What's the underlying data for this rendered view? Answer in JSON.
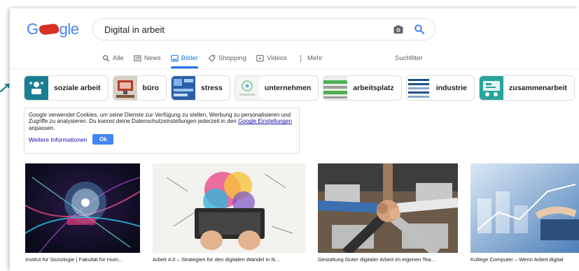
{
  "logo": {
    "g": "G",
    "gle": "gle"
  },
  "search": {
    "query": "Digital in arbeit"
  },
  "tabs": [
    {
      "label": "Alle",
      "icon": "search-icon"
    },
    {
      "label": "News",
      "icon": "news-icon"
    },
    {
      "label": "Bilder",
      "icon": "image-icon"
    },
    {
      "label": "Shopping",
      "icon": "tag-icon"
    },
    {
      "label": "Videos",
      "icon": "video-icon"
    },
    {
      "label": "Mehr",
      "icon": "more-vert-icon"
    }
  ],
  "filter_label": "Suchfilter",
  "chips": [
    {
      "label": "soziale arbeit"
    },
    {
      "label": "büro"
    },
    {
      "label": "stress"
    },
    {
      "label": "unternehmen"
    },
    {
      "label": "arbeitsplatz"
    },
    {
      "label": "industrie"
    },
    {
      "label": "zusammenarbeit"
    }
  ],
  "cookie": {
    "text_before": "Google verwendet Cookies, um seine Dienste zur Verfügung zu stellen, Werbung zu personalisieren und Zugriffe zu analysieren. Du kannst deine Datenschutzeinstellungen jederzeit in den ",
    "link": "Google Einstellungen",
    "text_after": " anpassen.",
    "more": "Weitere Informationen",
    "ok": "Ok"
  },
  "results": [
    {
      "caption": "Institut für Soziologie | Fakultät für Hum..."
    },
    {
      "caption": "Arbeit 4.0 – Strategien für den digitalen Wandel in N..."
    },
    {
      "caption": "Gestaltung Guter digitaler Arbeit im eigenen Tea..."
    },
    {
      "caption": "Kollege Computer – Wenn Arbeit digital"
    }
  ],
  "colors": {
    "accent": "#1a73e8",
    "link": "#1a0dab",
    "ok_button": "#4285f4"
  }
}
